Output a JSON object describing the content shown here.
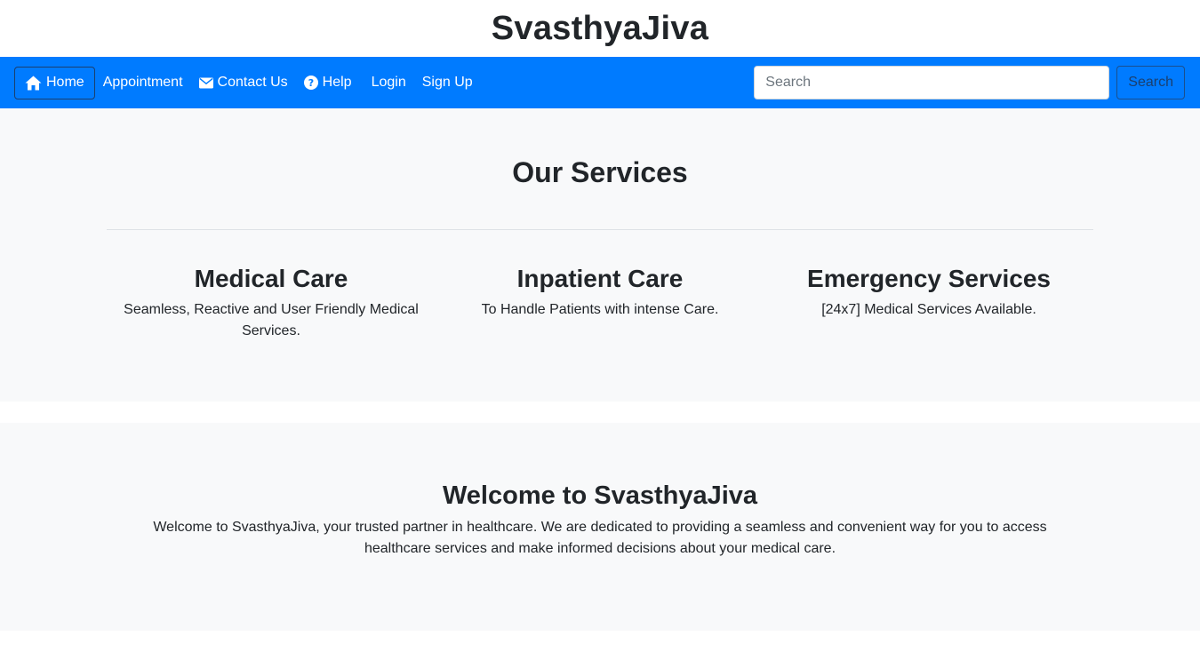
{
  "site": {
    "title": "SvasthyaJiva"
  },
  "navbar": {
    "background": "#007bff",
    "links": [
      {
        "label": "Home",
        "icon": "home-icon",
        "active": true
      },
      {
        "label": "Appointment",
        "icon": "",
        "active": false
      },
      {
        "label": "Contact Us",
        "icon": "envelope-icon",
        "active": false
      },
      {
        "label": "Help",
        "icon": "question-circle-icon",
        "active": false
      },
      {
        "label": "Login",
        "icon": "",
        "active": false
      },
      {
        "label": "Sign Up",
        "icon": "",
        "active": false
      }
    ],
    "search": {
      "placeholder": "Search",
      "value": "",
      "button_label": "Search"
    }
  },
  "services": {
    "heading": "Our Services",
    "items": [
      {
        "title": "Medical Care",
        "description": "Seamless, Reactive and User Friendly Medical Services."
      },
      {
        "title": "Inpatient Care",
        "description": "To Handle Patients with intense Care."
      },
      {
        "title": "Emergency Services",
        "description": "[24x7] Medical Services Available."
      }
    ]
  },
  "welcome": {
    "heading": "Welcome to SvasthyaJiva",
    "text": "Welcome to SvasthyaJiva, your trusted partner in healthcare. We are dedicated to providing a seamless and convenient way for you to access healthcare services and make informed decisions about your medical care."
  }
}
